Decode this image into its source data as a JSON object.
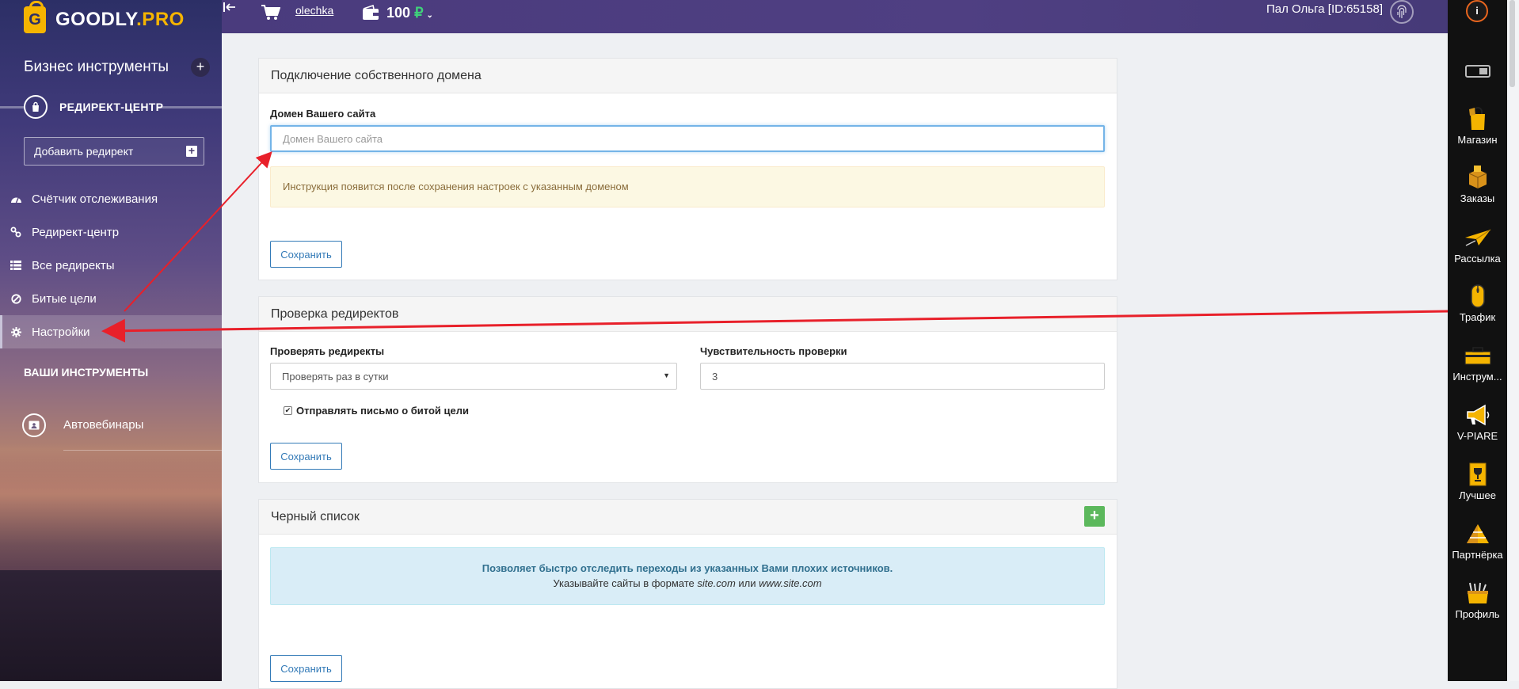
{
  "sidebar": {
    "logo_letter": "G",
    "logo_text": "GOODLY",
    "logo_suffix": ".PRO",
    "title": "Бизнес инструменты",
    "plus": "+",
    "section_label": "РЕДИРЕКТ-ЦЕНТР",
    "add_redirect_label": "Добавить редирект",
    "add_redirect_plus": "+",
    "nav": [
      {
        "label": "Счётчик отслеживания",
        "icon": "dashboard-icon"
      },
      {
        "label": "Редирект-центр",
        "icon": "link-icon"
      },
      {
        "label": "Все редиректы",
        "icon": "list-icon"
      },
      {
        "label": "Битые цели",
        "icon": "ban-icon"
      },
      {
        "label": "Настройки",
        "icon": "gear-icon",
        "active": true
      }
    ],
    "tools_heading": "ВАШИ ИНСТРУМЕНТЫ",
    "tool_label": "Автовебинары"
  },
  "topbar": {
    "username": "olechka",
    "balance": "100",
    "currency": "₽",
    "caret": "⌄",
    "account": "Пал Ольга [ID:65158]"
  },
  "rail": {
    "info": "i",
    "items": [
      {
        "label": "Магазин",
        "icon": "shopping-bag-icon"
      },
      {
        "label": "Заказы",
        "icon": "package-icon"
      },
      {
        "label": "Рассылка",
        "icon": "paper-plane-icon"
      },
      {
        "label": "Трафик",
        "icon": "mouse-icon"
      },
      {
        "label": "Инструм...",
        "icon": "toolbox-icon"
      },
      {
        "label": "V-PIARE",
        "icon": "megaphone-icon"
      },
      {
        "label": "Лучшее",
        "icon": "trophy-icon"
      },
      {
        "label": "Партнёрка",
        "icon": "pyramid-icon"
      },
      {
        "label": "Профиль",
        "icon": "profile-box-icon"
      }
    ]
  },
  "domain_panel": {
    "title": "Подключение собственного домена",
    "field_label": "Домен Вашего сайта",
    "placeholder": "Домен Вашего сайта",
    "notice": "Инструкция появится после сохранения настроек с указанным доменом",
    "save": "Сохранить"
  },
  "check_panel": {
    "title": "Проверка редиректов",
    "check_label": "Проверять редиректы",
    "check_value": "Проверять раз в сутки",
    "sensitivity_label": "Чувствительность проверки",
    "sensitivity_value": "3",
    "email_checkbox_label": "Отправлять письмо о битой цели",
    "email_checked": true,
    "save": "Сохранить"
  },
  "blacklist_panel": {
    "title": "Черный список",
    "info_strong": "Позволяет быстро отследить переходы из указанных Вами плохих источников.",
    "info_text_prefix": "Указывайте сайты в формате ",
    "example1": "site.com",
    "info_text_mid": " или ",
    "example2": "www.site.com",
    "save": "Сохранить"
  },
  "colors": {
    "accent": "#337ab7",
    "annotation_arrow": "#e8202a",
    "brand_yellow": "#f5b400",
    "success": "#5cb85c"
  }
}
